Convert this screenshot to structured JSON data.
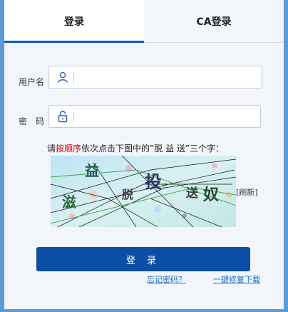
{
  "tabs": [
    {
      "label": "登录"
    },
    {
      "label": "CA登录"
    }
  ],
  "form": {
    "username_label": "用户名",
    "password_label": "密　码",
    "username_value": "",
    "password_value": ""
  },
  "captcha": {
    "prompt_pre": "请",
    "prompt_highlight": "按顺序",
    "prompt_post": "依次点击下图中的”脱  益  送”三个字：",
    "chars": [
      "滋",
      "益",
      "脱",
      "投",
      "送",
      "奴"
    ],
    "refresh_label": "[刷新]"
  },
  "actions": {
    "login_label": "登 录",
    "forgot_label": "忘记密码？",
    "repair_label": "一键修复下载"
  },
  "colors": {
    "accent": "#0a4ea6",
    "highlight": "#e00000",
    "frame": "#5b9bd5"
  }
}
